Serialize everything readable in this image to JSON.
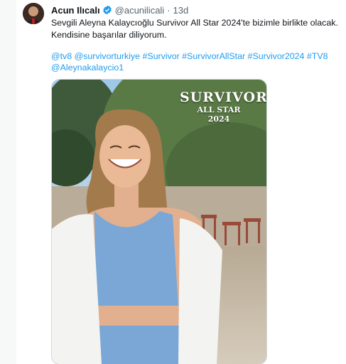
{
  "tweet": {
    "author_name": "Acun Ilıcalı",
    "handle": "@acunilicali",
    "separator": "·",
    "time": "13d",
    "text_lines": [
      "Sevgili Aleyna Kalaycıoğlu Survivor All Star 2024'te bizimle birlikte olacak.",
      "Kendisine başarılar diliyorum."
    ],
    "tags_line1": [
      "@tv8",
      "@survivorturkiye",
      "#Survivor",
      "#SurvivorAllStar",
      "#Survivor2024",
      "#TV8"
    ],
    "tags_line2": [
      "@Aleynakalaycio1"
    ]
  },
  "media": {
    "logo_word": "SURVIVOR",
    "logo_sub1": "ALL STAR",
    "logo_sub2": "2024"
  },
  "colors": {
    "link": "#1d9bf0",
    "verified": "#1d9bf0",
    "text": "#0f1419",
    "muted": "#536471"
  }
}
